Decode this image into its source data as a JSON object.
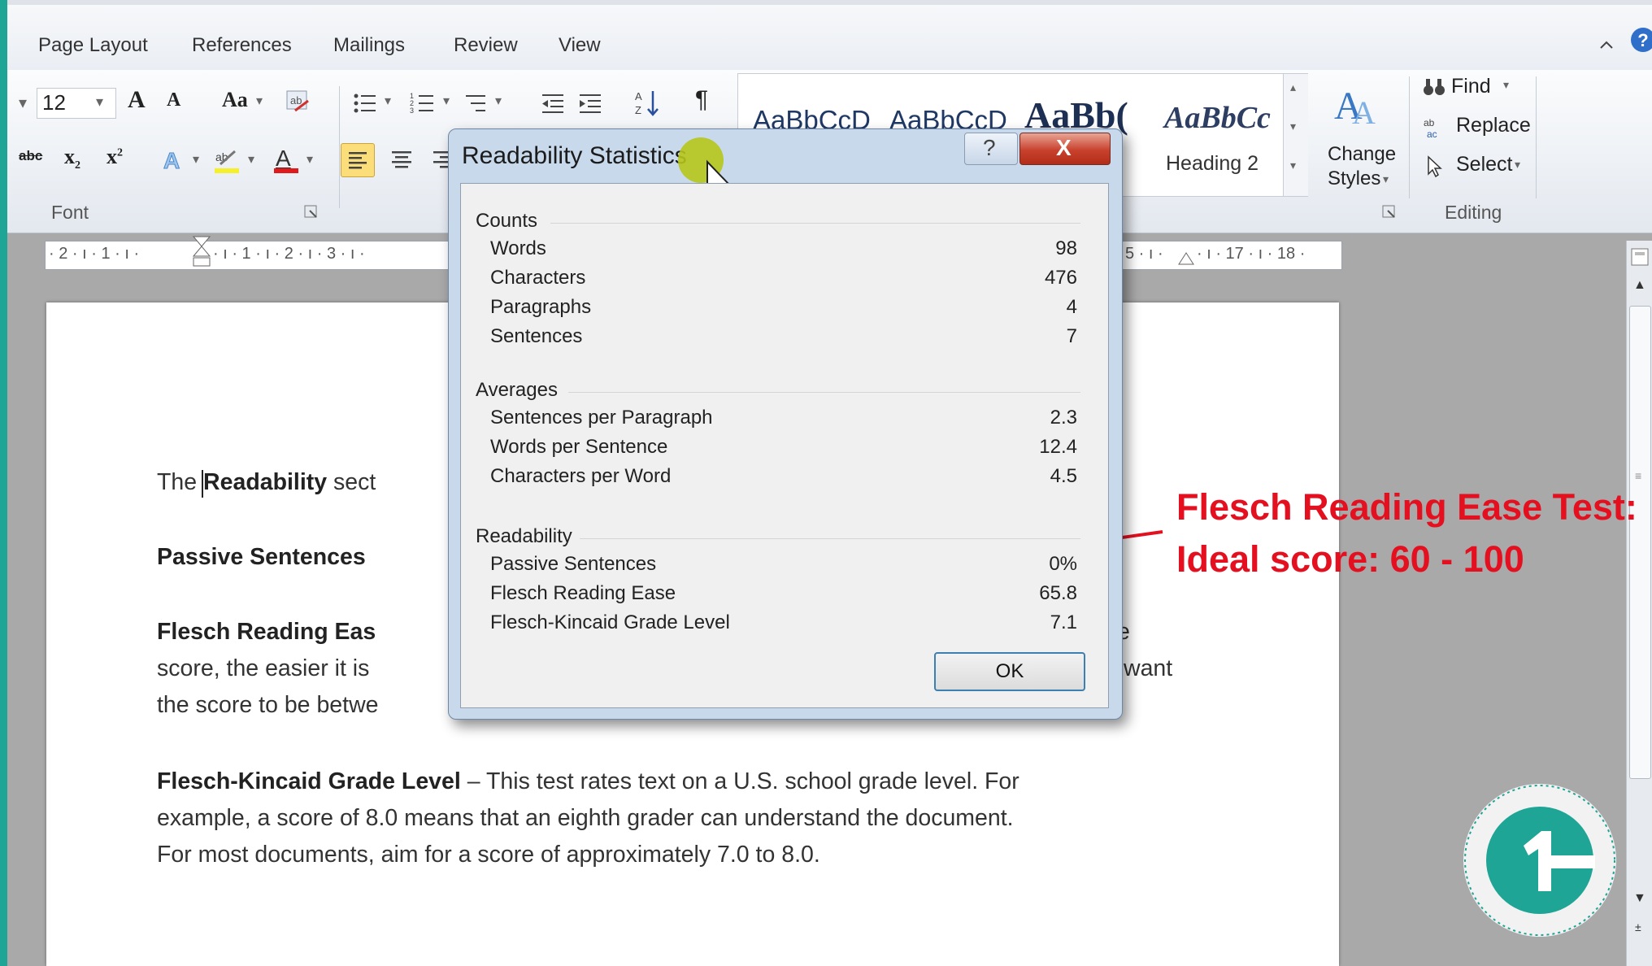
{
  "ribbon_tabs": [
    "Page Layout",
    "References",
    "Mailings",
    "Review",
    "View"
  ],
  "font_group": {
    "size": "12",
    "label": "Font",
    "grow": "A",
    "shrink": "A",
    "case": "Aa",
    "strike": "abc"
  },
  "styles": {
    "s1": "AaBbCcD",
    "s2": "AaBbCcD",
    "s3": "AaBb(",
    "s4": "AaBbCc",
    "heading2": "Heading 2",
    "change": "Change",
    "styles": "Styles"
  },
  "editing": {
    "find": "Find",
    "replace": "Replace",
    "select": "Select",
    "label": "Editing"
  },
  "ruler": {
    "left": "· 2 · ı · 1 · ı ·",
    "mid": "· ı · 1 · ı · 2 · ı · 3 · ı ·",
    "right": "5 · ı ·",
    "r17": "· ı · 17 · ı · 18 ·"
  },
  "dialog": {
    "title": "Readability Statistics",
    "help": "?",
    "close": "X",
    "ok": "OK",
    "counts": {
      "heading": "Counts",
      "rows": [
        {
          "label": "Words",
          "value": "98"
        },
        {
          "label": "Characters",
          "value": "476"
        },
        {
          "label": "Paragraphs",
          "value": "4"
        },
        {
          "label": "Sentences",
          "value": "7"
        }
      ]
    },
    "averages": {
      "heading": "Averages",
      "rows": [
        {
          "label": "Sentences per Paragraph",
          "value": "2.3"
        },
        {
          "label": "Words per Sentence",
          "value": "12.4"
        },
        {
          "label": "Characters per Word",
          "value": "4.5"
        }
      ]
    },
    "readability": {
      "heading": "Readability",
      "rows": [
        {
          "label": "Passive Sentences",
          "value": "0%"
        },
        {
          "label": "Flesch Reading Ease",
          "value": "65.8"
        },
        {
          "label": "Flesch-Kincaid Grade Level",
          "value": "7.1"
        }
      ]
    }
  },
  "document": {
    "p1_pre": "The ",
    "p1_bold": "Readability",
    "p1_rest": " sect",
    "p2_bold": "Passive Sentences",
    "p3_bold": "Flesch Reading Eas",
    "p3_right": "e",
    "p3_line2": "score, the easier it is",
    "p3_line2_right": "want",
    "p3_line3": "the score to be betwe",
    "p4_bold": "Flesch-Kincaid Grade Level",
    "p4_rest": " – This test rates text on a U.S. school grade level. For",
    "p4_line2": "example, a score of 8.0 means that an eighth grader can understand the document.",
    "p4_line3": "For most documents, aim for a score of approximately 7.0 to 8.0."
  },
  "annotation": {
    "line1": "Flesch Reading Ease Test:",
    "line2": "Ideal score: 60 - 100",
    "color": "#e4101f"
  },
  "colors": {
    "teal": "#1fa596",
    "ribbon": "#e9edf3",
    "dialog_frame": "#c9d9ec"
  }
}
